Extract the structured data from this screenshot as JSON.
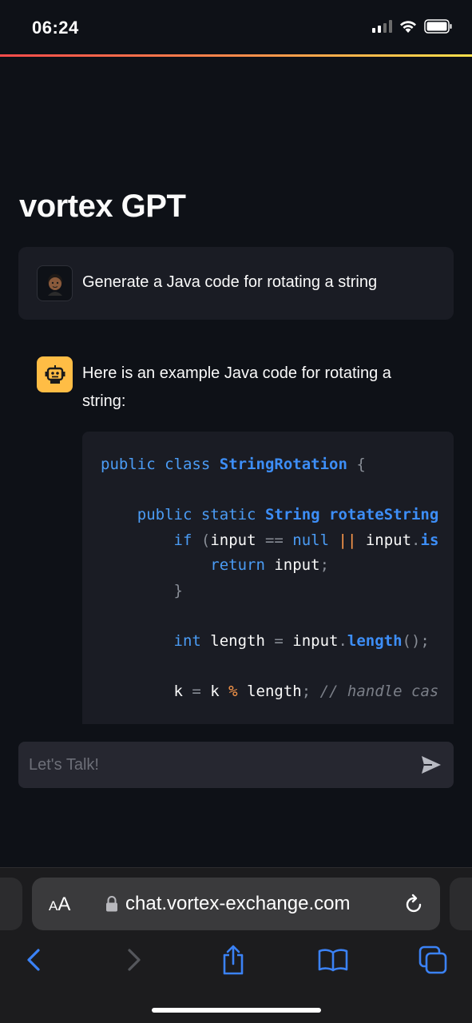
{
  "status_bar": {
    "time": "06:24"
  },
  "app": {
    "title": "vortex GPT"
  },
  "user_message": {
    "text": "Generate a Java code for rotating a string"
  },
  "assistant_message": {
    "text": "Here is an example Java code for rotating a string:",
    "code_lines": [
      "public class StringRotation {",
      "",
      "    public static String rotateString",
      "        if (input == null || input.is",
      "            return input;",
      "        }",
      "",
      "        int length = input.length();",
      "",
      "        k = k % length; // handle cas"
    ]
  },
  "chat_input": {
    "placeholder": "Let's Talk!",
    "value": ""
  },
  "browser": {
    "text_size_label": "AA",
    "url": "chat.vortex-exchange.com"
  },
  "colors": {
    "background": "#0e1117",
    "message_bg": "#1a1c24",
    "bot_avatar": "#ffbd45",
    "keyword": "#4b9cf5",
    "accent_gradient": [
      "#ff4b4b",
      "#ffe14b"
    ]
  },
  "icons": [
    "signal-icon",
    "wifi-icon",
    "battery-icon",
    "user-avatar-icon",
    "robot-icon",
    "send-icon",
    "lock-icon",
    "reload-icon",
    "back-icon",
    "forward-icon",
    "share-icon",
    "bookmarks-icon",
    "tabs-icon"
  ]
}
